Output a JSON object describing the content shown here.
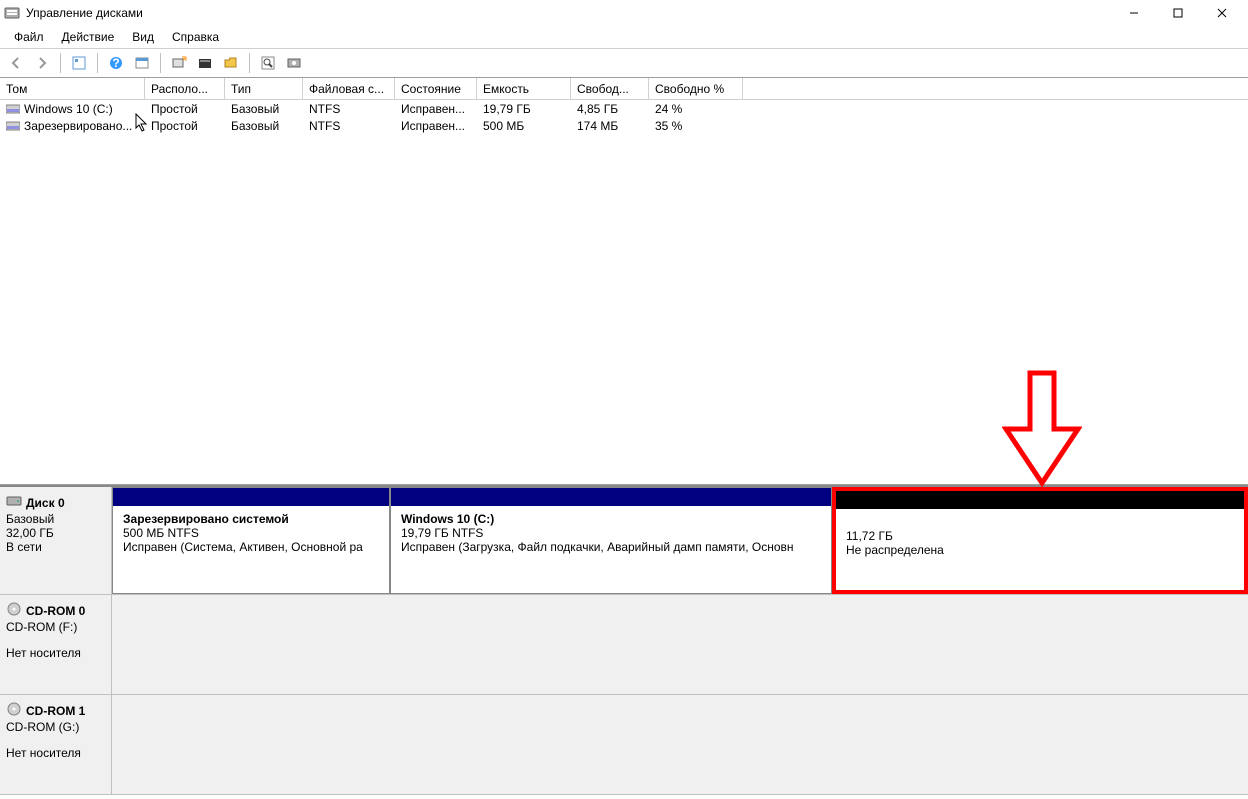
{
  "window": {
    "title": "Управление дисками"
  },
  "menu": {
    "file": "Файл",
    "action": "Действие",
    "view": "Вид",
    "help": "Справка"
  },
  "columns": {
    "volume": "Том",
    "layout": "Располо...",
    "type": "Тип",
    "fs": "Файловая с...",
    "status": "Состояние",
    "capacity": "Емкость",
    "free": "Свобод...",
    "freepct": "Свободно %"
  },
  "volumes": [
    {
      "name": "Windows 10 (C:)",
      "layout": "Простой",
      "type": "Базовый",
      "fs": "NTFS",
      "status": "Исправен...",
      "capacity": "19,79 ГБ",
      "free": "4,85 ГБ",
      "freepct": "24 %"
    },
    {
      "name": "Зарезервировано...",
      "layout": "Простой",
      "type": "Базовый",
      "fs": "NTFS",
      "status": "Исправен...",
      "capacity": "500 МБ",
      "free": "174 МБ",
      "freepct": "35 %"
    }
  ],
  "disks": {
    "d0": {
      "name": "Диск 0",
      "type": "Базовый",
      "size": "32,00 ГБ",
      "status": "В сети"
    },
    "cd0": {
      "name": "CD-ROM 0",
      "drive": "CD-ROM (F:)",
      "status": "Нет носителя"
    },
    "cd1": {
      "name": "CD-ROM 1",
      "drive": "CD-ROM (G:)",
      "status": "Нет носителя"
    }
  },
  "partitions": {
    "p1": {
      "name": "Зарезервировано системой",
      "size": "500 МБ NTFS",
      "status": "Исправен (Система, Активен, Основной ра"
    },
    "p2": {
      "name": "Windows 10  (C:)",
      "size": "19,79 ГБ NTFS",
      "status": "Исправен (Загрузка, Файл подкачки, Аварийный дамп памяти, Основн"
    },
    "p3": {
      "size": "11,72 ГБ",
      "status": "Не распределена"
    }
  }
}
